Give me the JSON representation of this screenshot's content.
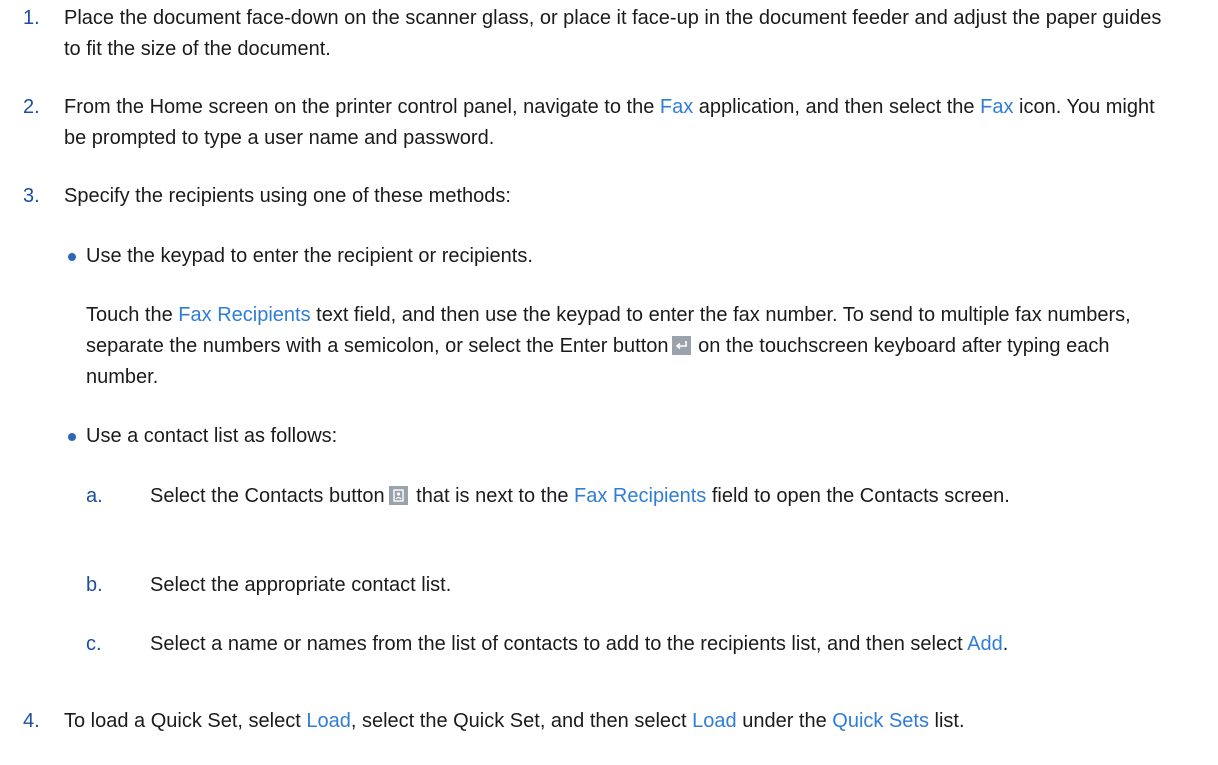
{
  "steps": [
    {
      "num": "1.",
      "parts": [
        {
          "t": "Place the document face-down on the scanner glass, or place it face-up in the document feeder and adjust the paper guides to fit the size of the document."
        }
      ]
    },
    {
      "num": "2.",
      "p1": "From the Home screen on the printer control panel, navigate to the ",
      "l1": "Fax",
      "p2": " application, and then select the ",
      "l2": "Fax",
      "p3": " icon. You might be prompted to type a user name and password."
    },
    {
      "num": "3.",
      "text": "Specify the recipients using one of these methods:",
      "bullet1": {
        "text": "Use the keypad to enter the recipient or recipients.",
        "p1": "Touch the ",
        "l1": "Fax Recipients",
        "p2": " text field, and then use the keypad to enter the fax number. To send to multiple fax numbers, separate the numbers with a semicolon, or select the Enter button",
        "p3": " on the touchscreen keyboard after typing each number."
      },
      "bullet2": {
        "text": "Use a contact list as follows:",
        "a": {
          "letter": "a.",
          "p1": "Select the Contacts button",
          "p2": " that is next to the ",
          "l1": "Fax Recipients",
          "p3": " field to open the Contacts screen."
        },
        "b": {
          "letter": "b.",
          "text": "Select the appropriate contact list."
        },
        "c": {
          "letter": "c.",
          "p1": "Select a name or names from the list of contacts to add to the recipients list, and then select ",
          "l1": "Add",
          "p2": "."
        }
      }
    },
    {
      "num": "4.",
      "p1": "To load a Quick Set, select ",
      "l1": "Load",
      "p2": ", select the Quick Set, and then select ",
      "l2": "Load",
      "p3": " under the ",
      "l3": "Quick Sets",
      "p4": " list."
    }
  ],
  "icons": {
    "enter": "enter-key-icon",
    "contacts": "contacts-icon"
  },
  "colors": {
    "text": "#1b1b1b",
    "number": "#1a4fa0",
    "link": "#2f7dd6",
    "icon_bg": "#9aa3ab"
  }
}
